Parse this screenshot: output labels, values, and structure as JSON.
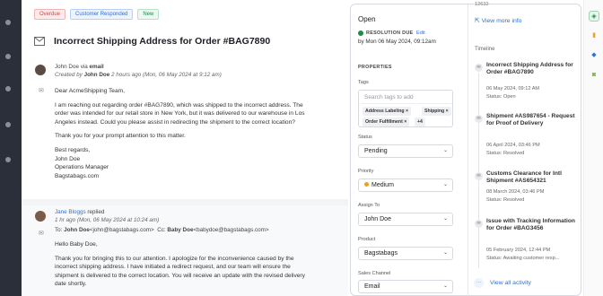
{
  "badges": [
    "Overdue",
    "Customer Responded",
    "New"
  ],
  "ticket": {
    "title": "Incorrect Shipping Address for Order #BAG7890"
  },
  "message1": {
    "author": "John Doe",
    "via": "via",
    "channel": "email",
    "created_by_label": "Created by",
    "created_by_name": "John Doe",
    "time": "2 hours ago (Mon, 06 May 2024 at 9:12 am)",
    "lines": [
      "Dear AcmeShipping Team,",
      "I am reaching out regarding order #BAG7890, which was shipped to the incorrect address. The",
      "order was intended for our retail store in New York, but it was delivered to our warehouse in Los",
      "Angeles instead. Could you please assist in redirecting the shipment to the correct location?",
      "Thank you for your prompt attention to this matter.",
      "Best regards,",
      "John Doe",
      "Operations Manager",
      "Bagstabags.com"
    ]
  },
  "message2": {
    "author": "Jane Bloggs",
    "action": "replied",
    "time": "1 hr ago (Mon, 06 May 2024 at 10:24 am)",
    "to_label": "To:",
    "to": "John Doe",
    "to_email": "<john@bagstabags.com>",
    "cc_label": "Cc:",
    "cc": "Baby Doe",
    "cc_email": "<babydoe@bagstabags.com>",
    "lines": [
      "Hello Baby Doe,",
      "Thank you for bringing this to our attention. I apologize for the inconvenience caused by the",
      "incorrect shipping address. I have initiated a redirect request, and our team will ensure the",
      "shipment is delivered to the correct location. You will receive an update with the revised delivery",
      "date shortly."
    ]
  },
  "panel": {
    "status_header": "Open",
    "due_label": "RESOLUTION DUE",
    "edit": "Edit",
    "due_value": "by Mon 06 May 2024, 09:12am",
    "properties": "PROPERTIES",
    "tags_label": "Tags",
    "tags_placeholder": "Search tags to add",
    "tags": [
      "Address Labeling",
      "Shipping",
      "Order Fulfillment",
      "+4"
    ],
    "status_label": "Status",
    "status_value": "Pending",
    "priority_label": "Priority",
    "priority_value": "Medium",
    "assign_label": "Assign To",
    "assign_value": "John Doe",
    "product_label": "Product",
    "product_value": "Bagstabags",
    "sales_label": "Sales Channel",
    "sales_value": "Email",
    "top_cut": "12632",
    "view_more": "View more info",
    "timeline_label": "Timeline",
    "timeline": [
      {
        "title": "Incorrect Shipping Address for Order #BAG7890",
        "date": "06 May 2024, 09:12 AM",
        "status": "Status: Open"
      },
      {
        "title": "Shipment #AS987654 - Request for Proof of Delivery",
        "date": "06 April 2024, 03:46 PM",
        "status": "Status: Resolved"
      },
      {
        "title": "Customs Clearance for Intl Shipment #AS654321",
        "date": "08 March 2024, 03:46 PM",
        "status": "Status: Resolved"
      },
      {
        "title": "Issue with Tracking Information for Order #BAG3456",
        "date": "05 February 2024, 12:44 PM",
        "status": "Status: Awaiting customer resp..."
      }
    ],
    "view_all": "View all activity"
  },
  "colors": {
    "accent": "#2f6fd6",
    "green": "#1f8a4c",
    "red": "#d14343",
    "priority": "#f0a020"
  }
}
